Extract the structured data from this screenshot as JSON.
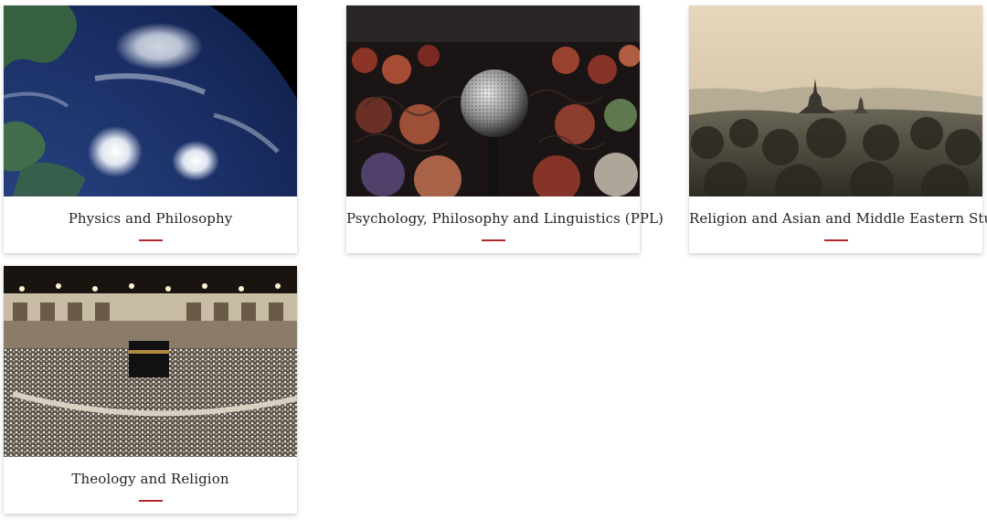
{
  "accent_color": "#b3262c",
  "cards": [
    {
      "title": "Physics and Philosophy",
      "image": "earth-from-space-hurricanes"
    },
    {
      "title": "Psychology, Philosophy and Linguistics (PPL)",
      "image": "microphone-in-front-of-audience"
    },
    {
      "title": "Religion and Asian and Middle Eastern Studies",
      "image": "temples-in-misty-forest"
    },
    {
      "title": "Theology and Religion",
      "image": "kaaba-crowd-at-night"
    }
  ]
}
